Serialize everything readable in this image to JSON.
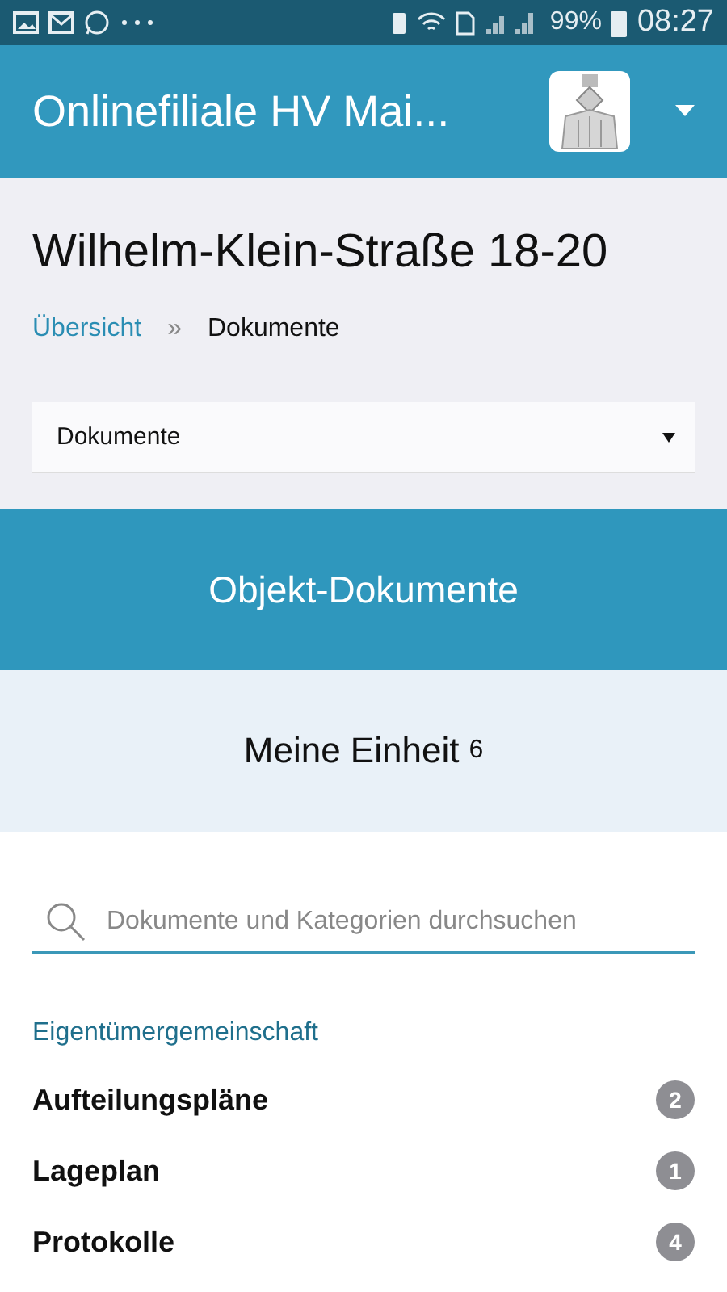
{
  "status_bar": {
    "battery": "99%",
    "time": "08:27"
  },
  "header": {
    "title": "Onlinefiliale HV Mai..."
  },
  "page_title": "Wilhelm-Klein-Straße 18-20",
  "breadcrumb": [
    {
      "label": "Übersicht",
      "kind": "link"
    },
    {
      "label": "»",
      "kind": "separator"
    },
    {
      "label": "Dokumente",
      "kind": "current"
    }
  ],
  "select": {
    "value": "Dokumente"
  },
  "banner": "Objekt-Dokumente",
  "unit": {
    "label": "Meine Einheit",
    "count": "6"
  },
  "search": {
    "placeholder": "Dokumente und Kategorien durchsuchen"
  },
  "category": "Eigentümergemeinschaft",
  "items": [
    {
      "label": "Aufteilungspläne",
      "count": "2"
    },
    {
      "label": "Lageplan",
      "count": "1"
    },
    {
      "label": "Protokolle",
      "count": "4"
    }
  ]
}
